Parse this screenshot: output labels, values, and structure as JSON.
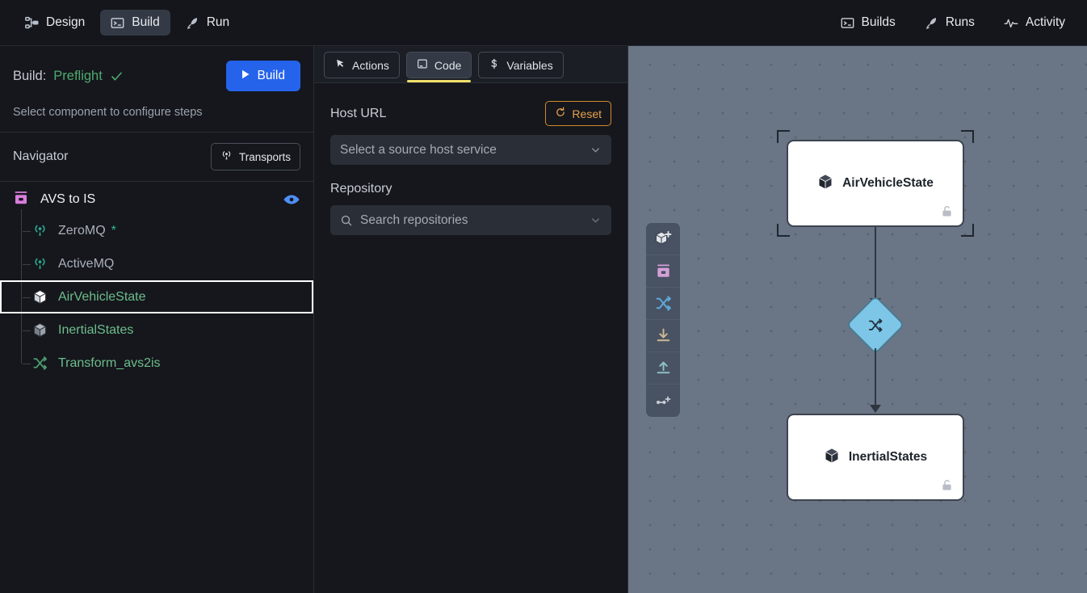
{
  "topbar": {
    "left_items": [
      {
        "label": "Design",
        "icon": "sitemap-icon",
        "active": false
      },
      {
        "label": "Build",
        "icon": "terminal-icon",
        "active": true
      },
      {
        "label": "Run",
        "icon": "rocket-icon",
        "active": false
      }
    ],
    "right_items": [
      {
        "label": "Builds",
        "icon": "terminal-icon"
      },
      {
        "label": "Runs",
        "icon": "rocket-icon"
      },
      {
        "label": "Activity",
        "icon": "activity-pulse-icon"
      }
    ]
  },
  "left_panel": {
    "build": {
      "label": "Build:",
      "status": "Preflight",
      "status_icon": "check-icon",
      "status_color": "#4ea96f",
      "button_label": "Build",
      "button_icon": "play-icon",
      "button_color": "#2563eb",
      "hint": "Select component to configure steps"
    },
    "navigator": {
      "title": "Navigator",
      "transports_label": "Transports",
      "transports_icon": "broadcast-icon"
    },
    "tree": {
      "root": {
        "label": "AVS to IS",
        "icon": "archive-icon",
        "icon_color": "#d87ddb",
        "eye_icon": "eye-icon",
        "eye_color": "#4f8ef7"
      },
      "items": [
        {
          "label": "ZeroMQ",
          "icon": "broadcast-icon",
          "icon_color": "#2fa58e",
          "label_style": "muted",
          "badge": "*",
          "selected": false
        },
        {
          "label": "ActiveMQ",
          "icon": "broadcast-icon",
          "icon_color": "#2fa58e",
          "label_style": "muted",
          "badge": "",
          "selected": false
        },
        {
          "label": "AirVehicleState",
          "icon": "cube-icon",
          "icon_color": "#ffffff",
          "label_style": "green",
          "badge": "",
          "selected": true
        },
        {
          "label": "InertialStates",
          "icon": "cube-icon",
          "icon_color": "#8f96a1",
          "label_style": "green",
          "badge": "",
          "selected": false
        },
        {
          "label": "Transform_avs2is",
          "icon": "shuffle-icon",
          "icon_color": "#4d9c6e",
          "label_style": "green",
          "badge": "",
          "selected": false
        }
      ]
    }
  },
  "center_panel": {
    "tabs": [
      {
        "label": "Actions",
        "icon": "cursor-arrow-icon",
        "active": false
      },
      {
        "label": "Code",
        "icon": "window-icon",
        "active": true
      },
      {
        "label": "Variables",
        "icon": "dollar-icon",
        "active": false
      }
    ],
    "active_tab_underline_color": "#f0e06a",
    "host_url": {
      "label": "Host URL",
      "reset_label": "Reset",
      "reset_icon": "reset-icon",
      "reset_color": "#e8a24a",
      "placeholder": "Select a source host service",
      "value": "",
      "chevron_icon": "chevron-down-icon"
    },
    "repository": {
      "label": "Repository",
      "placeholder": "Search repositories",
      "value": "",
      "search_icon": "search-icon",
      "chevron_icon": "chevron-down-icon"
    }
  },
  "canvas": {
    "background_color": "#6a7585",
    "toolbar": [
      {
        "name": "add-component-icon",
        "color": "#e8eaee"
      },
      {
        "name": "archive-icon",
        "color": "#d4a0d8"
      },
      {
        "name": "shuffle-icon",
        "color": "#5fa8d8"
      },
      {
        "name": "download-icon",
        "color": "#cbb994"
      },
      {
        "name": "upload-icon",
        "color": "#8fc0c2"
      },
      {
        "name": "connect-nodes-icon",
        "color": "#c7ccd4"
      }
    ],
    "nodes": [
      {
        "label": "AirVehicleState",
        "icon": "cube-icon",
        "lock_icon": "unlock-icon",
        "selected": true
      },
      {
        "label": "InertialStates",
        "icon": "cube-icon",
        "lock_icon": "unlock-icon",
        "selected": false
      }
    ],
    "transform_node": {
      "icon": "shuffle-icon",
      "color": "#7ec6e8"
    }
  }
}
